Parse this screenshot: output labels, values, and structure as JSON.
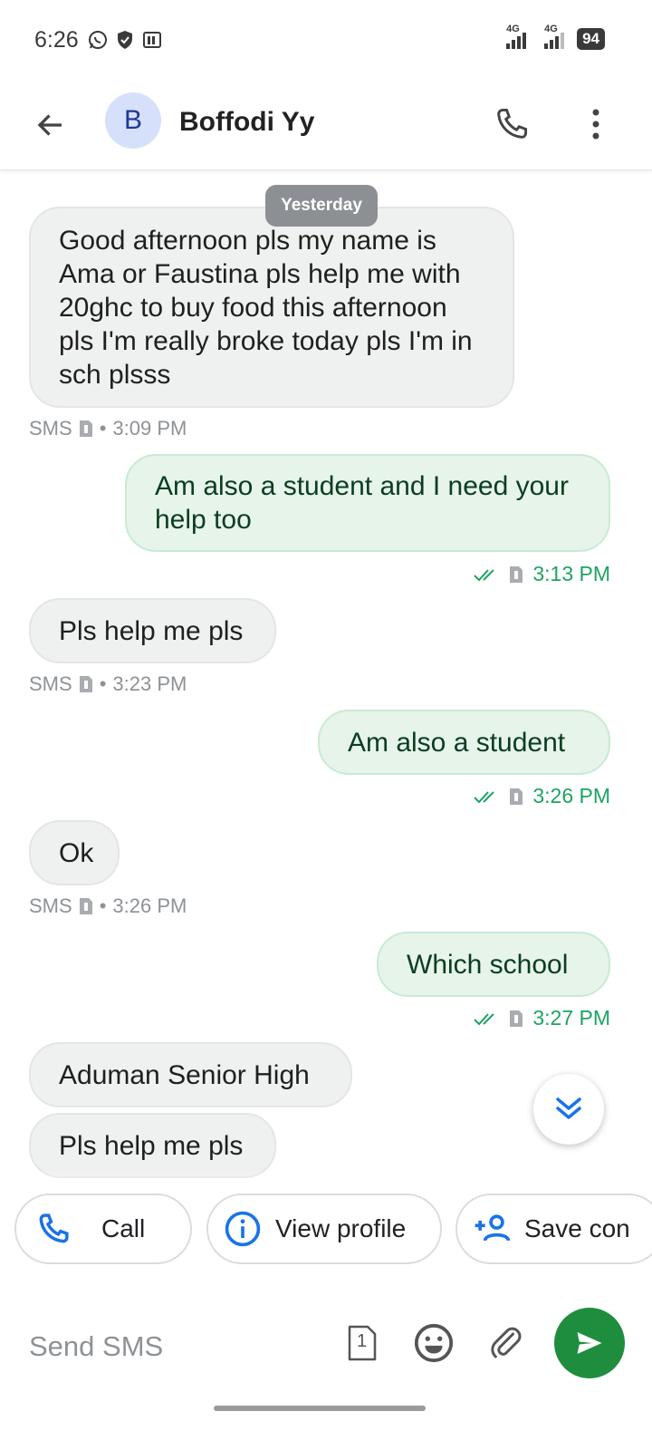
{
  "status_bar": {
    "time": "6:26",
    "net1": "4G",
    "net2": "4G",
    "battery": "94"
  },
  "header": {
    "avatar_letter": "B",
    "contact_name": "Boffodi Yy"
  },
  "messages": {
    "date_chip": "Yesterday",
    "items": [
      {
        "direction": "in",
        "text": "Good afternoon pls my name is Ama or Faustina pls help me with 20ghc to buy food this afternoon pls I'm really broke today pls I'm in sch plsss",
        "meta_label": "SMS",
        "time": "3:09 PM"
      },
      {
        "direction": "out",
        "text": "Am also a student and I need your help too",
        "time": "3:13 PM"
      },
      {
        "direction": "in",
        "text": "Pls help me pls",
        "meta_label": "SMS",
        "time": "3:23 PM"
      },
      {
        "direction": "out",
        "text": "Am also a student",
        "time": "3:26 PM"
      },
      {
        "direction": "in",
        "text": "Ok",
        "meta_label": "SMS",
        "time": "3:26 PM"
      },
      {
        "direction": "out",
        "text": "Which school",
        "time": "3:27 PM"
      },
      {
        "direction": "in",
        "text": "Aduman Senior High"
      },
      {
        "direction": "in",
        "text": "Pls help me pls"
      }
    ],
    "separator": "•"
  },
  "actions": {
    "call": "Call",
    "view_profile": "View profile",
    "save_contact": "Save con"
  },
  "composer": {
    "placeholder": "Send SMS",
    "sim_number": "1"
  },
  "colors": {
    "outgoing_bubble": "#e6f4ea",
    "incoming_bubble": "#eff0f0",
    "send_button": "#1e8e3e",
    "accent_blue": "#1a73e8"
  }
}
